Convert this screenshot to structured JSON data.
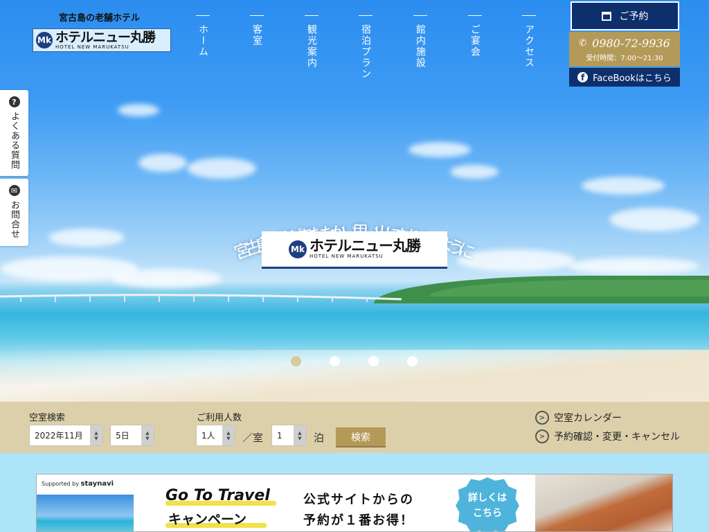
{
  "header": {
    "tagline": "宮古島の老舗ホテル",
    "logo_jp": "ホテルニュー丸勝",
    "logo_en": "HOTEL NEW MARUKATSU",
    "logo_mark": "Mk"
  },
  "nav": {
    "items": [
      "ホーム",
      "客室",
      "観光案内",
      "宿泊プラン",
      "館内施設",
      "ご宴会",
      "アクセス"
    ]
  },
  "actions": {
    "reserve": "ご予約",
    "phone": "0980-72-9936",
    "phone_symbol": "✆",
    "hours": "受付時間：7:00～21:30",
    "facebook": "FaceBookはこちら"
  },
  "side": {
    "faq": "よくある質問",
    "contact": "お問合せ"
  },
  "hero": {
    "catchphrase": "宮古島の旅があたたかい思い出になりますように",
    "logo_jp": "ホテルニュー丸勝",
    "logo_en": "HOTEL NEW MARUKATSU",
    "slide_count": 4,
    "active_slide": 1
  },
  "search": {
    "label_vacancy": "空室検索",
    "month_value": "2022年11月",
    "day_value": "5日",
    "label_people": "ご利用人数",
    "people_value": "1人",
    "per_room": "／室",
    "nights_value": "1",
    "nights_unit": "泊",
    "search_button": "検索",
    "link_calendar": "空室カレンダー",
    "link_manage": "予約確認・変更・キャンセル"
  },
  "banner": {
    "supported_by": "Supported by",
    "supported_brand": "staynavi",
    "title_line1": "Go To Travel",
    "title_line2": "キャンペーン",
    "message_line1": "公式サイトからの",
    "message_line2": "予約が１番お得！",
    "badge_line1": "詳しくは",
    "badge_line2": "こちら"
  },
  "colors": {
    "navy": "#0d2f6b",
    "gold": "#b39a58",
    "search_bg": "#dcd0aa",
    "page_bg": "#aee4f8"
  }
}
